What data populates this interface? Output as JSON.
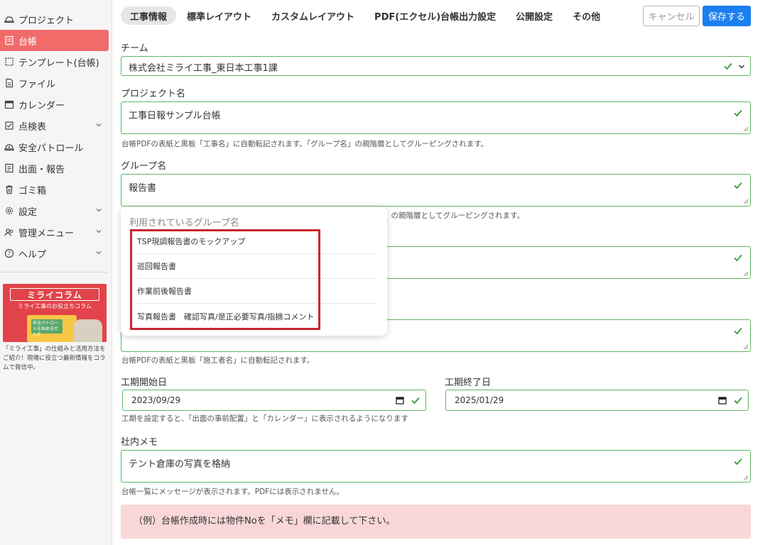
{
  "sidebar": {
    "items": [
      {
        "label": "プロジェクト",
        "icon": "hard-hat-icon"
      },
      {
        "label": "台帳",
        "icon": "ledger-icon",
        "active": true
      },
      {
        "label": "テンプレート(台帳)",
        "icon": "template-icon"
      },
      {
        "label": "ファイル",
        "icon": "file-icon"
      },
      {
        "label": "カレンダー",
        "icon": "calendar-icon"
      },
      {
        "label": "点検表",
        "icon": "checklist-icon",
        "expandable": true
      },
      {
        "label": "安全パトロール",
        "icon": "safety-patrol-icon"
      },
      {
        "label": "出面・報告",
        "icon": "report-icon"
      },
      {
        "label": "ゴミ箱",
        "icon": "trash-icon"
      },
      {
        "label": "設定",
        "icon": "gear-icon",
        "expandable": true
      },
      {
        "label": "管理メニュー",
        "icon": "users-icon",
        "expandable": true
      },
      {
        "label": "ヘルプ",
        "icon": "help-icon",
        "expandable": true
      }
    ],
    "banner": {
      "title": "ミライコラム",
      "subtitle": "ミライ工事のお役立ちコラム",
      "card_text": "安全パトロールを始めませんか",
      "description": "「ミライ工事」の仕組みと活用方法をご紹介！現場に役立つ最新情報をコラムで発信中。"
    }
  },
  "tabs": [
    {
      "label": "工事情報",
      "active": true
    },
    {
      "label": "標準レイアウト"
    },
    {
      "label": "カスタムレイアウト"
    },
    {
      "label": "PDF(エクセル)台帳出力設定"
    },
    {
      "label": "公開設定"
    },
    {
      "label": "その他"
    }
  ],
  "actions": {
    "cancel": "キャンセル",
    "save": "保存する"
  },
  "form": {
    "team": {
      "label": "チーム",
      "value": "株式会社ミライ工事_東日本工事1課"
    },
    "project_name": {
      "label": "プロジェクト名",
      "value": "工事日報サンプル台帳",
      "help": "台帳PDFの表紙と黒板「工事名」に自動転記されます。「グループ名」の親階層としてグルーピングされます。"
    },
    "group_name": {
      "label": "グループ名",
      "value": "報告書",
      "help_tail": "」の親階層としてグルーピングされます。"
    },
    "contractor_help": "台帳PDFの表紙と黒板「施工者名」に自動転記されます。",
    "start_date": {
      "label": "工期開始日",
      "value": "2023/09/29"
    },
    "end_date": {
      "label": "工期終了日",
      "value": "2025/01/29"
    },
    "date_help": "工期を設定すると、「出面の事前配置」と「カレンダー」に表示されるようになります",
    "memo": {
      "label": "社内メモ",
      "value": "テント倉庫の写真を格納",
      "help": "台帳一覧にメッセージが表示されます。PDFには表示されません。"
    },
    "note": "（例）台帳作成時には物件Noを「メモ」欄に記載して下さい。"
  },
  "group_popup": {
    "header": "利用されているグループ名",
    "options": [
      "TSP現調報告書のモックアップ",
      "巡回報告書",
      "作業前後報告書",
      "写真報告書　確認写真/是正必要写真/指摘コメント"
    ]
  },
  "colors": {
    "accent": "#1a7ff0",
    "active_nav": "#f26b6b",
    "valid_border": "#5fb85f",
    "highlight_box": "#c8262d",
    "note_bg": "#f9d7d9"
  }
}
